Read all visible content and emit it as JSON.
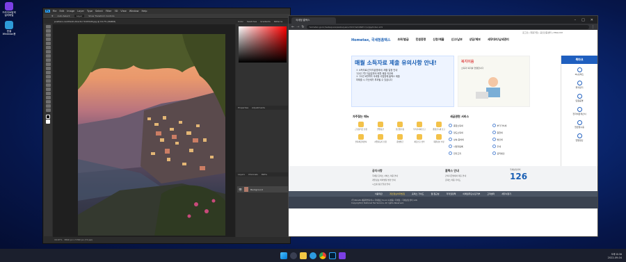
{
  "desktop": {
    "icons": [
      {
        "label": "드라이브탐색 설치파일",
        "color": "#7b3fe4"
      },
      {
        "label": "한셀 Windows용",
        "color": "#2e9bd8"
      }
    ]
  },
  "photoshop": {
    "menus": [
      "File",
      "Edit",
      "Image",
      "Layer",
      "Type",
      "Select",
      "Filter",
      "3D",
      "View",
      "Window",
      "Help"
    ],
    "options": [
      "Auto-Select:",
      "Layer",
      "Show Transform Controls"
    ],
    "doc_tab": "positano-nanthanh-director 5193126.jpg @ 16.7% (RGB/8)",
    "panel_tabs": [
      "Color",
      "Swatches",
      "Gradients",
      "Patterns"
    ],
    "mid_tabs": [
      "Properties",
      "Adjustments"
    ],
    "layers_tabs": [
      "Layers",
      "Channels",
      "Paths"
    ],
    "layer_name": "Background",
    "zoom": "16.67%",
    "status": "3840 px x 5760 px (72 ppi)"
  },
  "chrome": {
    "tab_title": "국세청 홈택스",
    "url": "hometax.go.kr/websquare/websquare.html?w2xPath=/ui/pp/index.xml",
    "top_links": [
      "로그인",
      "회원가입",
      "공인인증센터",
      "ENGLISH"
    ],
    "brand": "Hometax, 국세청홈택스",
    "nav": [
      "조회/발급",
      "민원증명",
      "신청/제출",
      "신고/납부",
      "상담/제보",
      "세무대리/납세관리"
    ],
    "banner_title": "매월 소득자료 제출 유의사항 안내!",
    "banner_lines": [
      "① 소득자료(간이지급명세서) 제출 일정 안내",
      "'22년 7월 지급분부터 매월 제출 의무화",
      "② '22년 6월까지 국세청 사업장에 홈택스 제출",
      "미제출 시 가산세가 부과될 수 있습니다"
    ],
    "card2_title": "복지이음",
    "card2_sub": "소득과 복지를 연결합니다",
    "side_header": "북마크",
    "side_items": [
      "My홈택스",
      "즐겨찾기",
      "민원증명",
      "전자세금계산서",
      "현금영수증",
      "연말정산"
    ],
    "quick_title": "자주찾는 메뉴",
    "quick": [
      "근로장려금 신청",
      "연말정산",
      "현금영수증",
      "부가가치세 신고",
      "종합소득세 신고",
      "전자세금계산서",
      "사업자등록 신청",
      "증명발급",
      "세금신고 납부",
      "회원정보 수정"
    ],
    "services_title": "세금관련 서비스",
    "services": [
      "종합소득세",
      "부가가치세",
      "양도소득세",
      "원천세",
      "상속·증여세",
      "법인세",
      "사업자등록",
      "주세",
      "전자고지",
      "공익법인"
    ],
    "notice_title": "공지사항",
    "notice_lines": [
      "국세청 홈택스 서비스 이용 안내",
      "개인정보 처리방침 변경 안내",
      "시스템 점검 일정 안내"
    ],
    "event_title": "홈택스 안내",
    "event_lines": [
      "간이지급명세서 제출 안내",
      "홈택스 이용 가이드"
    ],
    "counsel_title": "국세상담센터",
    "counsel_num": "126",
    "foot_nav": [
      "이용약관",
      "개인정보처리방침",
      "홈택스 가이드",
      "웹 접근성",
      "저작권정책",
      "이메일무단수집거부",
      "고객센터",
      "세무서찾기"
    ],
    "footer_lines": [
      "(우)30128 세종특별자치시 국세청로 8-14 (나성동) 국세청 / 국세상담센터 126",
      "Copyright(c) National Tax Service. All rights Reserved."
    ]
  },
  "tray": {
    "time": "오후 8:06",
    "date": "2022-09-04"
  },
  "colors": {
    "desktop": "#0b2a78",
    "taskbar": "#1b1f2d",
    "brand_blue": "#1a5fb4"
  }
}
